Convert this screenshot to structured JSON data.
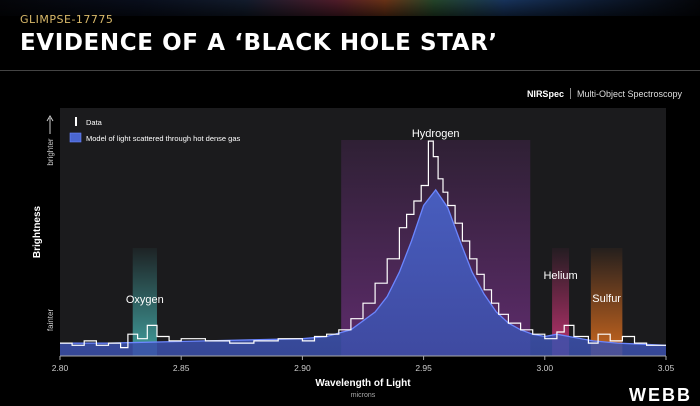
{
  "header": {
    "kicker": "GLIMPSE-17775",
    "title": "EVIDENCE OF A ‘BLACK HOLE STAR’"
  },
  "instrument": {
    "name": "NIRSpec",
    "mode": "Multi-Object Spectroscopy"
  },
  "watermark": "WEBB",
  "colors": {
    "panel": "#1b1b1d",
    "data_line": "#ffffff",
    "model_fill": "#3d56b8",
    "model_line": "#6b86ff",
    "oxygen": "#48b8b6",
    "hydrogen": "#6a2f7a",
    "helium": "#d2367a",
    "sulfur": "#e0701f"
  },
  "chart_data": {
    "type": "line",
    "xlabel": "Wavelength of Light",
    "xunit": "microns",
    "ylabel": "Brightness",
    "y_top_label": "brighter",
    "y_bottom_label": "fainter",
    "xlim": [
      2.8,
      3.05
    ],
    "ylim": [
      0,
      1
    ],
    "xticks": [
      "2.80",
      "2.85",
      "2.90",
      "2.95",
      "3.00",
      "3.05"
    ],
    "legend": {
      "placement": "top-left",
      "entries": [
        "Data",
        "Model of light scattered through hot dense gas"
      ]
    },
    "regions": [
      {
        "label": "Oxygen",
        "x_start": 2.83,
        "x_end": 2.84,
        "color": "#48b8b6"
      },
      {
        "label": "Hydrogen",
        "x_start": 2.916,
        "x_end": 2.994,
        "color": "#6a2f7a"
      },
      {
        "label": "Helium",
        "x_start": 3.003,
        "x_end": 3.01,
        "color": "#d2367a"
      },
      {
        "label": "Sulfur",
        "x_start": 3.019,
        "x_end": 3.032,
        "color": "#e0701f"
      }
    ],
    "series": [
      {
        "name": "Data",
        "style": "step",
        "x": [
          2.8,
          2.805,
          2.81,
          2.815,
          2.82,
          2.825,
          2.828,
          2.832,
          2.836,
          2.84,
          2.845,
          2.85,
          2.86,
          2.87,
          2.88,
          2.89,
          2.9,
          2.905,
          2.91,
          2.915,
          2.92,
          2.925,
          2.93,
          2.935,
          2.94,
          2.943,
          2.946,
          2.949,
          2.952,
          2.954,
          2.956,
          2.958,
          2.96,
          2.963,
          2.966,
          2.969,
          2.972,
          2.975,
          2.978,
          2.981,
          2.985,
          2.99,
          2.995,
          3.0,
          3.005,
          3.008,
          3.012,
          3.018,
          3.022,
          3.027,
          3.032,
          3.037,
          3.042,
          3.05
        ],
        "y": [
          0.04,
          0.03,
          0.05,
          0.03,
          0.04,
          0.02,
          0.08,
          0.06,
          0.12,
          0.07,
          0.05,
          0.06,
          0.05,
          0.04,
          0.05,
          0.06,
          0.05,
          0.07,
          0.08,
          0.1,
          0.15,
          0.22,
          0.31,
          0.42,
          0.56,
          0.62,
          0.68,
          0.75,
          0.95,
          0.88,
          0.78,
          0.72,
          0.66,
          0.58,
          0.5,
          0.42,
          0.35,
          0.28,
          0.22,
          0.17,
          0.13,
          0.1,
          0.08,
          0.06,
          0.09,
          0.12,
          0.07,
          0.04,
          0.08,
          0.05,
          0.07,
          0.04,
          0.03,
          0.03
        ]
      },
      {
        "name": "Model of light scattered through hot dense gas",
        "style": "filled",
        "x": [
          2.8,
          2.82,
          2.84,
          2.86,
          2.88,
          2.9,
          2.91,
          2.92,
          2.93,
          2.935,
          2.94,
          2.945,
          2.95,
          2.955,
          2.96,
          2.965,
          2.97,
          2.975,
          2.98,
          2.985,
          2.99,
          2.995,
          3.0,
          3.005,
          3.01,
          3.02,
          3.03,
          3.05
        ],
        "y": [
          0.04,
          0.04,
          0.045,
          0.05,
          0.055,
          0.06,
          0.07,
          0.1,
          0.18,
          0.25,
          0.36,
          0.5,
          0.66,
          0.73,
          0.65,
          0.5,
          0.36,
          0.26,
          0.18,
          0.13,
          0.1,
          0.08,
          0.07,
          0.08,
          0.07,
          0.05,
          0.04,
          0.03
        ]
      }
    ]
  }
}
